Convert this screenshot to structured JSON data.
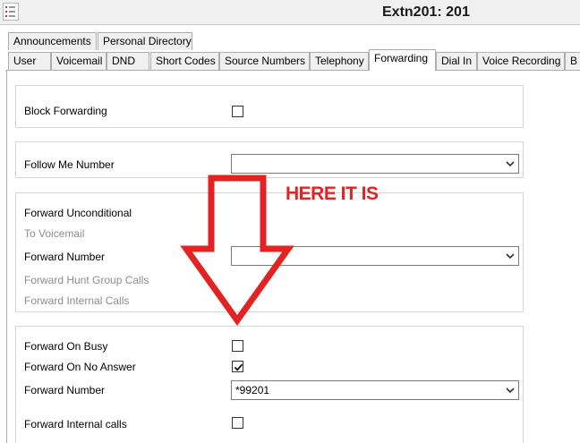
{
  "window": {
    "title": "Extn201: 201"
  },
  "tabs_row1": [
    "Announcements",
    "Personal Directory"
  ],
  "tabs_row2": [
    "User",
    "Voicemail",
    "DND",
    "Short Codes",
    "Source Numbers",
    "Telephony",
    "Forwarding",
    "Dial In",
    "Voice Recording",
    "B"
  ],
  "active_tab": "Forwarding",
  "block_forwarding": {
    "label": "Block Forwarding",
    "checked": false
  },
  "follow_me": {
    "label": "Follow Me Number",
    "value": ""
  },
  "unconditional": {
    "forward_unconditional": "Forward Unconditional",
    "to_voicemail": "To Voicemail",
    "forward_number": "Forward Number",
    "forward_number_value": "",
    "forward_hunt_group_calls": "Forward Hunt Group Calls",
    "forward_internal_calls": "Forward Internal Calls"
  },
  "busy_noanswer": {
    "forward_on_busy": "Forward On Busy",
    "forward_on_busy_checked": false,
    "forward_on_no_answer": "Forward On No Answer",
    "forward_on_no_answer_checked": true,
    "forward_number": "Forward Number",
    "forward_number_value": "*99201",
    "forward_internal_calls": "Forward Internal calls",
    "forward_internal_calls_checked": false
  },
  "annotation": {
    "text": "HERE IT IS",
    "color": "#e32222"
  },
  "colors": {
    "arrow": "#e32222",
    "border": "#adadad",
    "disabled_text": "#8c8c8c"
  }
}
